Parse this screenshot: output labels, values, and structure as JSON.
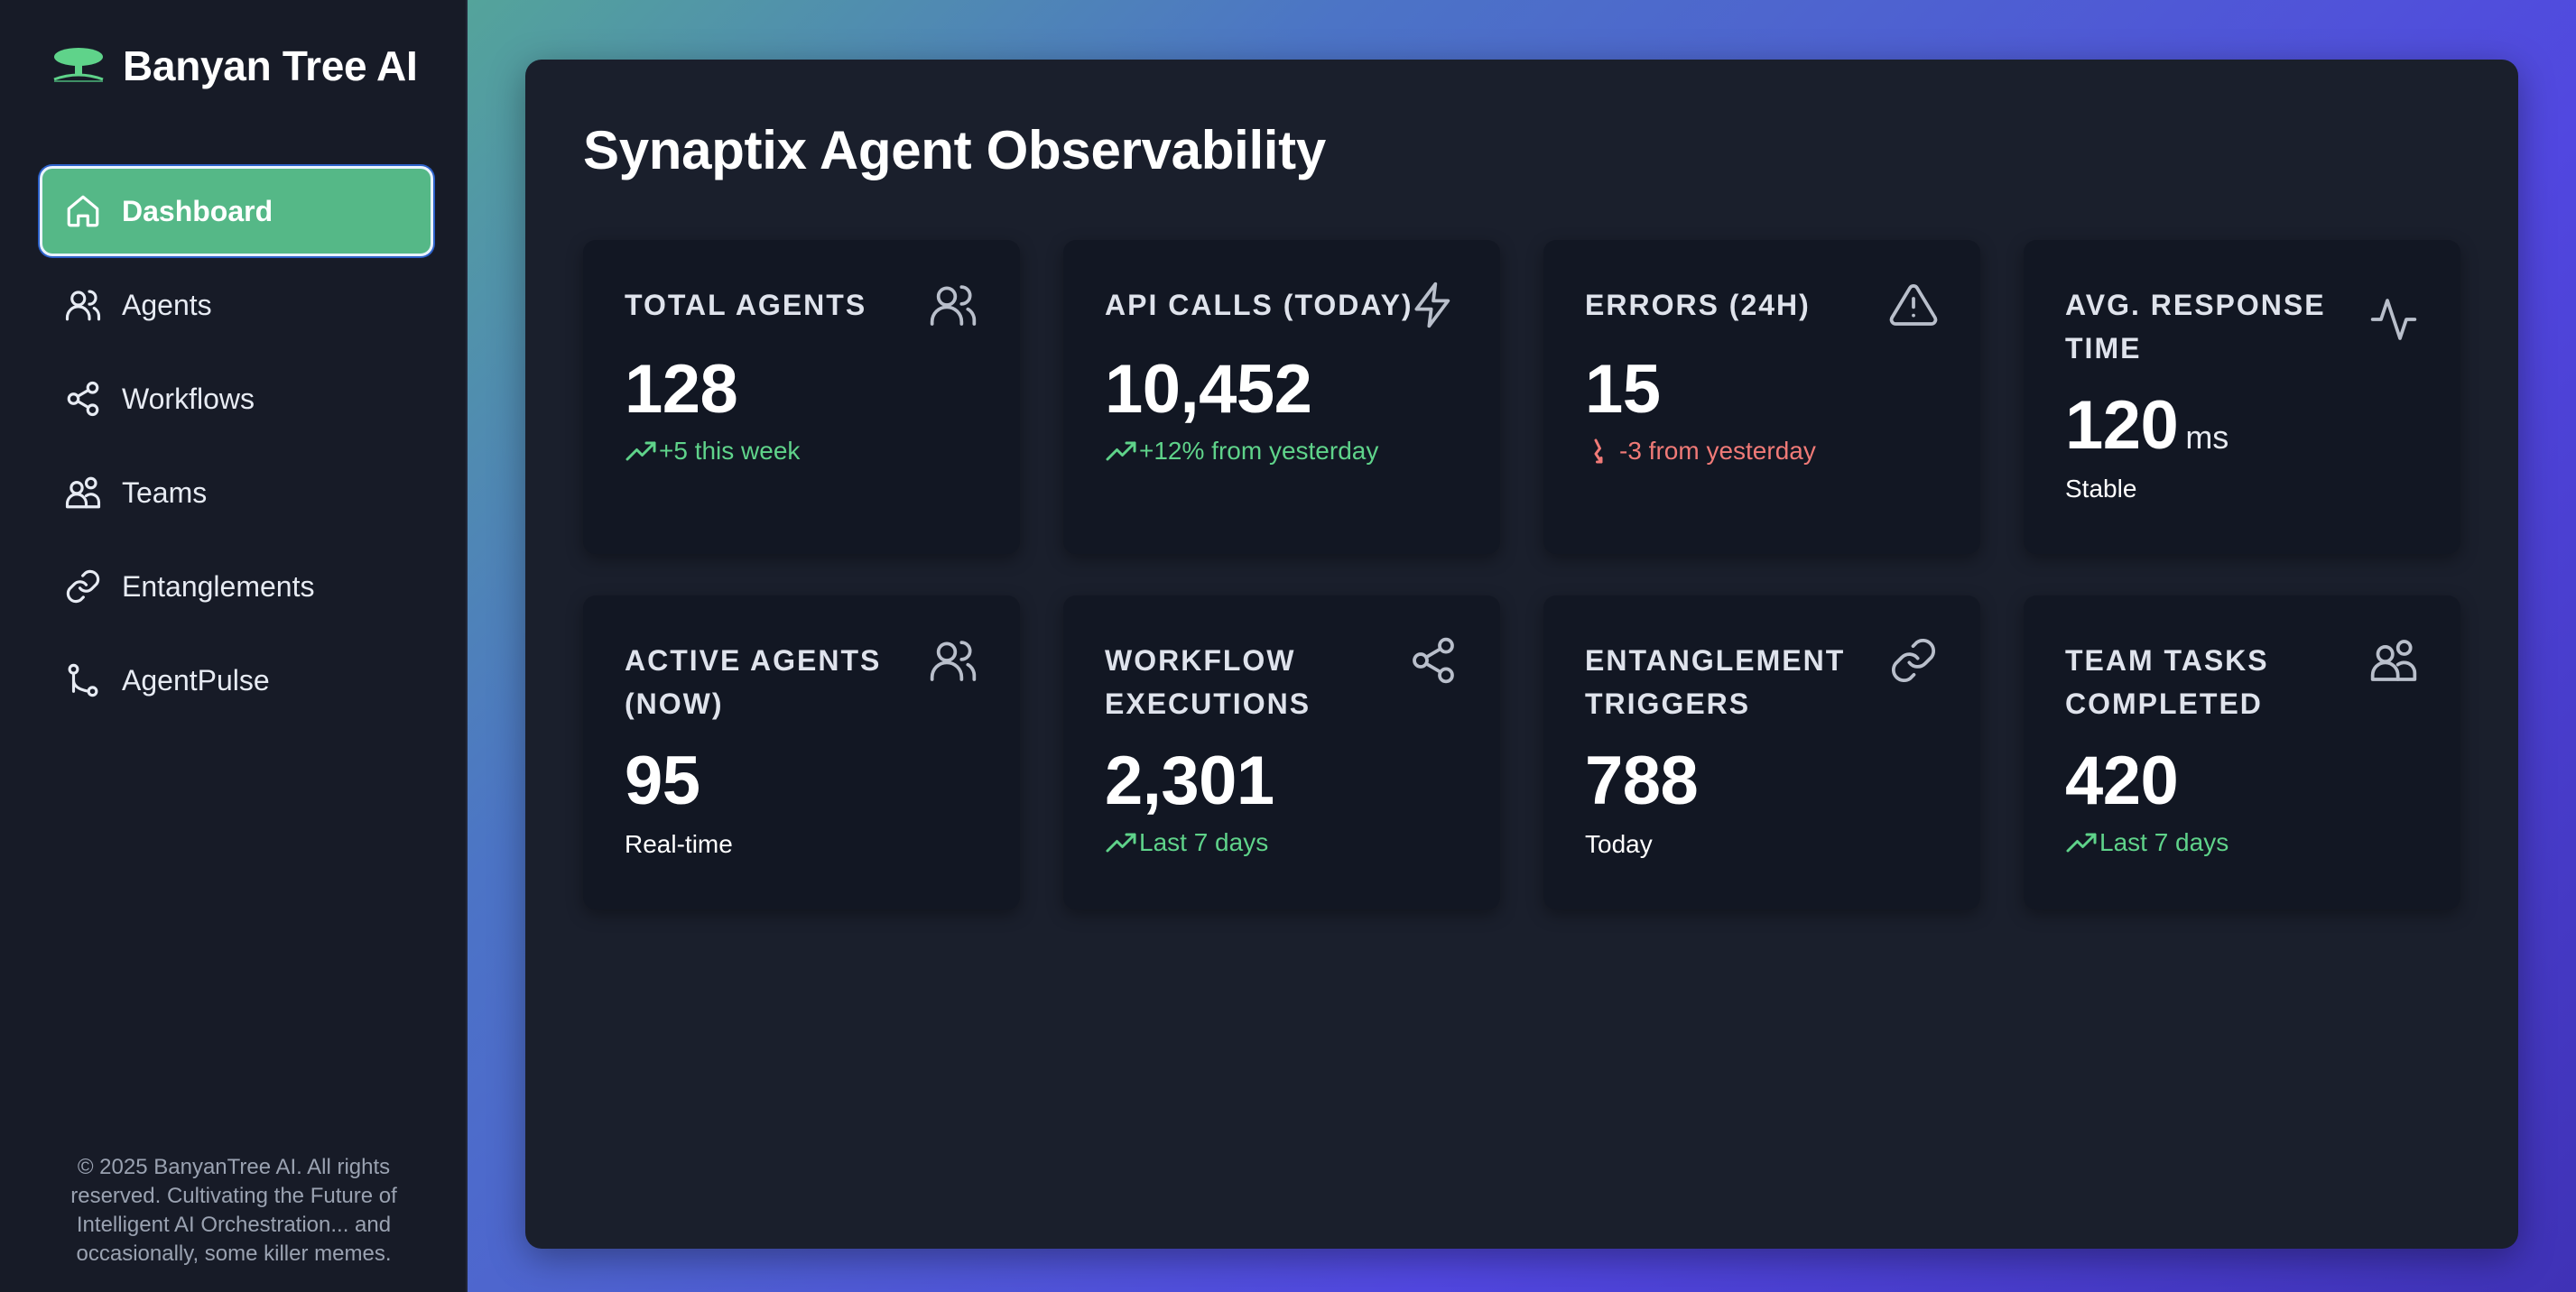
{
  "brand": {
    "name": "Banyan Tree AI"
  },
  "nav": {
    "items": [
      {
        "label": "Dashboard",
        "icon": "home-icon",
        "active": true
      },
      {
        "label": "Agents",
        "icon": "users-icon",
        "active": false
      },
      {
        "label": "Workflows",
        "icon": "share-icon",
        "active": false
      },
      {
        "label": "Teams",
        "icon": "teams-icon",
        "active": false
      },
      {
        "label": "Entanglements",
        "icon": "link-icon",
        "active": false
      },
      {
        "label": "AgentPulse",
        "icon": "route-icon",
        "active": false
      }
    ]
  },
  "footer": {
    "text": "© 2025 BanyanTree AI. All rights reserved. Cultivating the Future of Intelligent AI Orchestration... and occasionally, some killer memes."
  },
  "page": {
    "title": "Synaptix Agent Observability"
  },
  "cards": [
    {
      "title": "Total Agents",
      "value": "128",
      "unit": "",
      "sub": "+5 this week",
      "trend": "up",
      "icon": "users-icon"
    },
    {
      "title": "API Calls (Today)",
      "value": "10,452",
      "unit": "",
      "sub": "+12% from yesterday",
      "trend": "up",
      "icon": "lightning-icon"
    },
    {
      "title": "Errors (24h)",
      "value": "15",
      "unit": "",
      "sub": "-3 from yesterday",
      "trend": "down",
      "icon": "warning-icon"
    },
    {
      "title": "Avg. Response Time",
      "value": "120",
      "unit": "ms",
      "sub": "Stable",
      "trend": "none",
      "icon": "activity-icon"
    },
    {
      "title": "Active Agents (Now)",
      "value": "95",
      "unit": "",
      "sub": "Real-time",
      "trend": "none",
      "icon": "users-icon"
    },
    {
      "title": "Workflow Executions",
      "value": "2,301",
      "unit": "",
      "sub": "Last 7 days",
      "trend": "up",
      "icon": "share-icon"
    },
    {
      "title": "Entanglement Triggers",
      "value": "788",
      "unit": "",
      "sub": "Today",
      "trend": "none",
      "icon": "link-icon"
    },
    {
      "title": "Team Tasks Completed",
      "value": "420",
      "unit": "",
      "sub": "Last 7 days",
      "trend": "up",
      "icon": "teams-icon"
    }
  ],
  "colors": {
    "accent_green": "#55b887",
    "trend_up": "#5fd38a",
    "trend_down": "#f07a77",
    "sidebar_bg": "#171b27",
    "panel_bg": "#1a1f2c",
    "card_bg": "#121723"
  }
}
